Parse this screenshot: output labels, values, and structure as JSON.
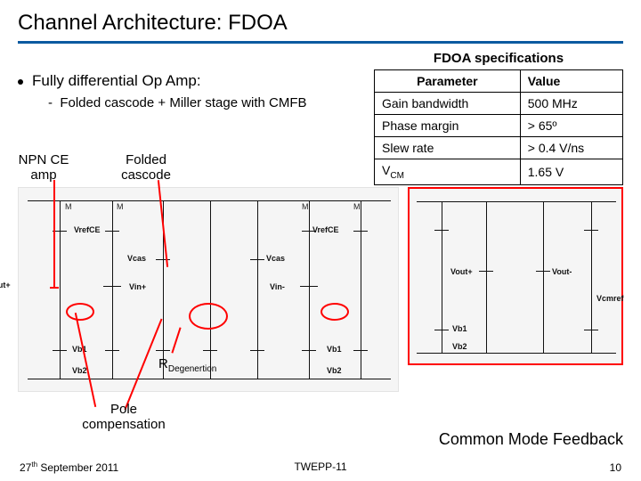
{
  "title": "Channel Architecture: FDOA",
  "bullet": {
    "main": "Fully differential Op Amp:",
    "sub": "Folded cascode + Miller stage with CMFB"
  },
  "specs": {
    "caption": "FDOA specifications",
    "header": {
      "param": "Parameter",
      "value": "Value"
    },
    "rows": [
      {
        "param": "Gain bandwidth",
        "value": "500 MHz"
      },
      {
        "param": "Phase margin",
        "value": "> 65º"
      },
      {
        "param": "Slew rate",
        "value": "> 0.4 V/ns"
      },
      {
        "param_html": "V<CM>",
        "value": "1.65 V"
      }
    ]
  },
  "callouts": {
    "npn": "NPN CE amp",
    "folded": "Folded cascode",
    "rdeg_pre": "R",
    "rdeg_sub": "Degenertion",
    "pole": "Pole compensation"
  },
  "nets": {
    "voutp": "Vout+",
    "voutm": "Vout-",
    "vrefce": "VrefCE",
    "vcas": "Vcas",
    "vinp": "Vin+",
    "vinm": "Vin-",
    "vb1": "Vb1",
    "vb2": "Vb2",
    "vcmref": "Vcmref"
  },
  "cmfb_title": "Common Mode Feedback",
  "footer": {
    "date_pre": "27",
    "date_sup": "th",
    "date_post": " September 2011",
    "conf": "TWEPP-11",
    "page": "10"
  }
}
